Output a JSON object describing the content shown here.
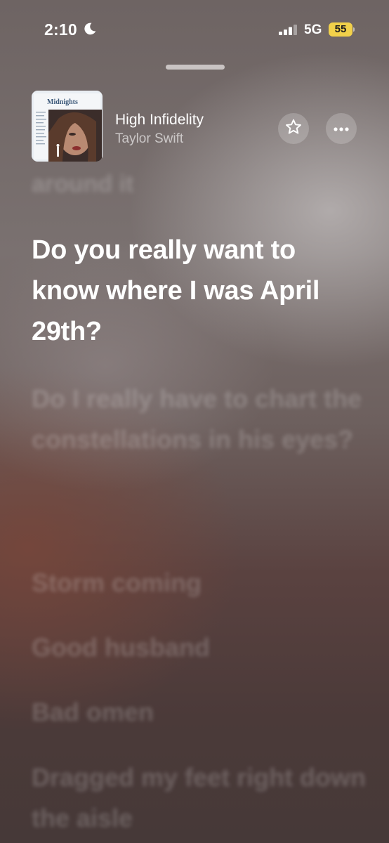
{
  "status_bar": {
    "time": "2:10",
    "network": "5G",
    "battery": "55",
    "icons": [
      "moon-icon",
      "cellular-signal-icon",
      "battery-icon"
    ],
    "battery_color": "#f2d14a"
  },
  "now_playing": {
    "album_art_text": "Midnights",
    "title": "High Infidelity",
    "artist": "Taylor Swift",
    "icons": [
      "star-icon",
      "ellipsis-icon"
    ]
  },
  "lyrics": {
    "previous": "around it",
    "current": "Do you really want to know where I was April 29th?",
    "upcoming": [
      "Do I really have to chart the constellations in his eyes?",
      "Storm coming",
      "Good husband",
      "Bad omen",
      "Dragged my feet right down the aisle"
    ]
  },
  "colors": {
    "current_lyric": "#ffffff",
    "dim_lyric": "rgba(255,255,255,0.20)"
  }
}
